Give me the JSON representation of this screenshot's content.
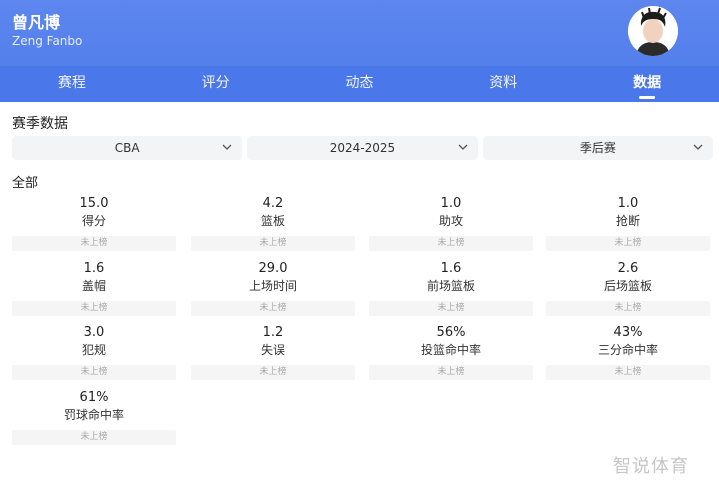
{
  "player": {
    "name": "曾凡博",
    "name_en": "Zeng Fanbo",
    "avatar_icon": "player-avatar"
  },
  "tabs": [
    {
      "label": "赛程",
      "active": false
    },
    {
      "label": "评分",
      "active": false
    },
    {
      "label": "动态",
      "active": false
    },
    {
      "label": "资料",
      "active": false
    },
    {
      "label": "数据",
      "active": true
    }
  ],
  "section": {
    "title": "赛季数据"
  },
  "filters": [
    {
      "label": "CBA",
      "icon": "chevron-down-icon"
    },
    {
      "label": "2024-2025",
      "icon": "chevron-down-icon"
    },
    {
      "label": "季后赛",
      "icon": "chevron-down-icon"
    }
  ],
  "group": {
    "title": "全部"
  },
  "stats": [
    {
      "value": "15.0",
      "label": "得分",
      "rank": "未上榜"
    },
    {
      "value": "4.2",
      "label": "篮板",
      "rank": "未上榜"
    },
    {
      "value": "1.0",
      "label": "助攻",
      "rank": "未上榜"
    },
    {
      "value": "1.0",
      "label": "抢断",
      "rank": "未上榜"
    },
    {
      "value": "1.6",
      "label": "盖帽",
      "rank": "未上榜"
    },
    {
      "value": "29.0",
      "label": "上场时间",
      "rank": "未上榜"
    },
    {
      "value": "1.6",
      "label": "前场篮板",
      "rank": "未上榜"
    },
    {
      "value": "2.6",
      "label": "后场篮板",
      "rank": "未上榜"
    },
    {
      "value": "3.0",
      "label": "犯规",
      "rank": "未上榜"
    },
    {
      "value": "1.2",
      "label": "失误",
      "rank": "未上榜"
    },
    {
      "value": "56%",
      "label": "投篮命中率",
      "rank": "未上榜"
    },
    {
      "value": "43%",
      "label": "三分命中率",
      "rank": "未上榜"
    },
    {
      "value": "61%",
      "label": "罚球命中率",
      "rank": "未上榜"
    }
  ],
  "watermark": "智说体育",
  "colors": {
    "header_top": "#5d86ee",
    "tab_bar": "#4a78ea",
    "rank_bg": "#f5f5f6"
  }
}
